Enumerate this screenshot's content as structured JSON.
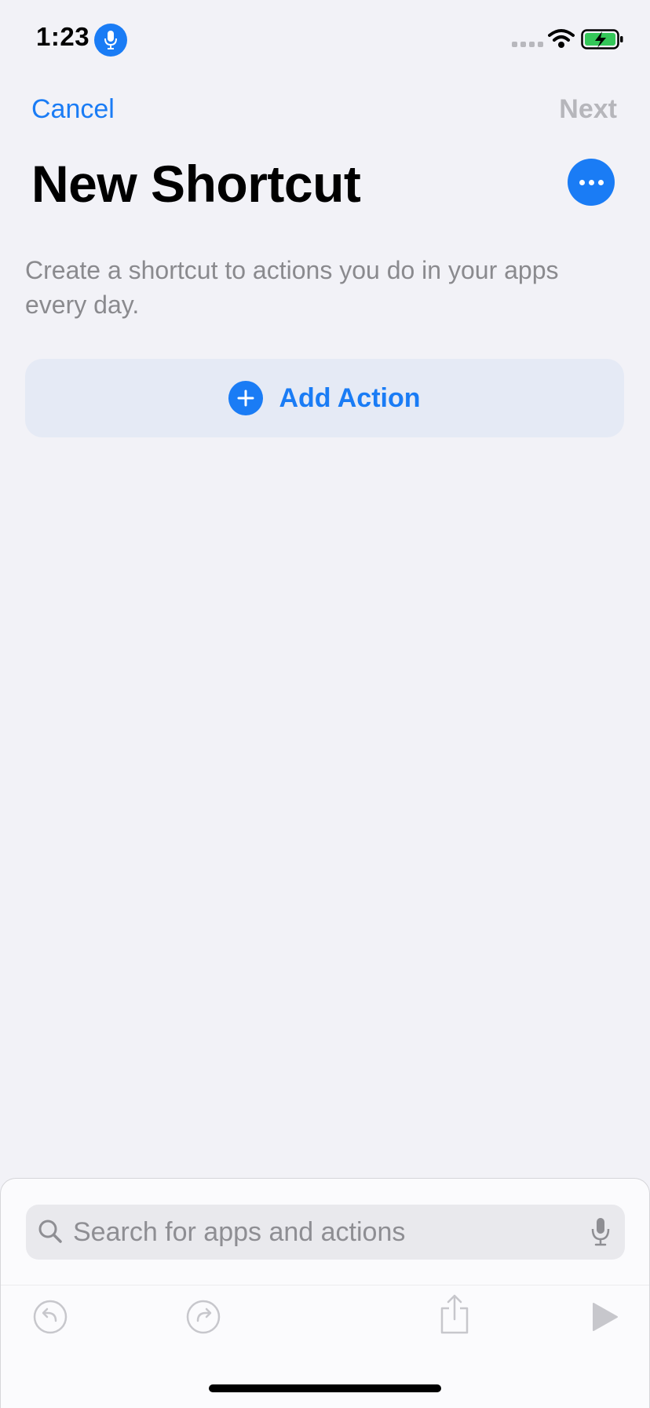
{
  "status_bar": {
    "time": "1:23",
    "icons": [
      "microphone-icon",
      "cellular-signal-icon",
      "wifi-icon",
      "battery-charging-icon"
    ]
  },
  "nav": {
    "cancel_label": "Cancel",
    "next_label": "Next"
  },
  "header": {
    "title": "New Shortcut",
    "more_icon": "ellipsis-icon"
  },
  "main": {
    "description": "Create a shortcut to actions you do in your apps every day.",
    "add_action_label": "Add Action"
  },
  "bottom_sheet": {
    "search_placeholder": "Search for apps and actions",
    "search_value": "",
    "toolbar_icons": [
      "undo-icon",
      "redo-icon",
      "share-icon",
      "play-icon"
    ]
  },
  "colors": {
    "accent": "#1a7cf5",
    "background": "#f2f2f7",
    "secondary_text": "#8a8a8e",
    "disabled": "#b6b6bb",
    "battery_fill": "#34c759"
  }
}
